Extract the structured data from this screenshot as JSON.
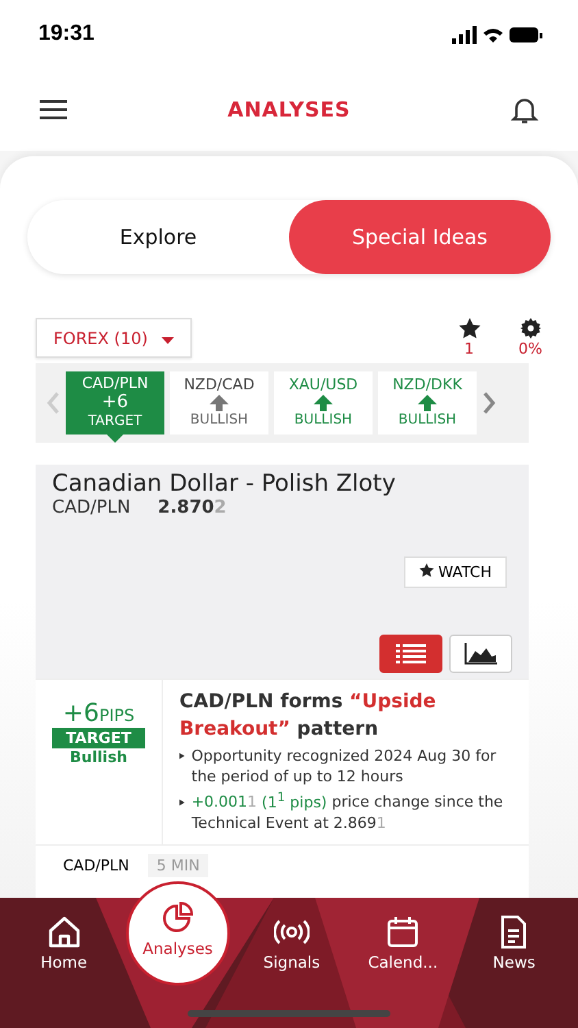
{
  "status_bar": {
    "time": "19:31"
  },
  "header": {
    "title": "ANALYSES"
  },
  "segments": [
    {
      "label": "Explore",
      "selected": false
    },
    {
      "label": "Special Ideas",
      "selected": true
    }
  ],
  "filter": {
    "label": "FOREX (10)"
  },
  "stats": {
    "watch_count": "1",
    "progress": "0%"
  },
  "tickers": [
    {
      "symbol": "CAD/PLN",
      "value": "+6",
      "status": "TARGET",
      "kind": "target",
      "selected": true
    },
    {
      "symbol": "NZD/CAD",
      "status": "BULLISH",
      "kind": "neutral",
      "selected": false
    },
    {
      "symbol": "XAU/USD",
      "status": "BULLISH",
      "kind": "up",
      "selected": false
    },
    {
      "symbol": "NZD/DKK",
      "status": "BULLISH",
      "kind": "up",
      "selected": false
    }
  ],
  "instrument": {
    "name": "Canadian Dollar - Polish Zloty",
    "symbol": "CAD/PLN",
    "price": "2.870",
    "price_tail": "2",
    "watch_label": "WATCH"
  },
  "view_toggle": [
    {
      "kind": "list",
      "selected": true
    },
    {
      "kind": "chart",
      "selected": false
    }
  ],
  "analysis": {
    "pips": "+6",
    "pips_unit": "PIPS",
    "badge": "TARGET",
    "direction": "Bullish",
    "headline": [
      {
        "text": "CAD/PLN forms ",
        "kind": "plain"
      },
      {
        "text": "“Upside Breakout”",
        "kind": "accent"
      },
      {
        "text": " pattern",
        "kind": "plain"
      }
    ],
    "bullets": [
      [
        {
          "text": "Opportunity recognized 2024 Aug 30 for the period of up to 12 hours",
          "kind": "plain"
        }
      ],
      [
        {
          "text": "+0.001",
          "kind": "green"
        },
        {
          "text": "1",
          "kind": "faint"
        },
        {
          "text": " (1$^{1}$ pips)",
          "kind": "green"
        },
        {
          "text": " price change since the Technical Event at 2.869",
          "kind": "plain"
        },
        {
          "text": "1",
          "kind": "faint"
        }
      ]
    ],
    "symbol": "CAD/PLN",
    "timeframe": "5 MIN"
  },
  "tab_bar": [
    {
      "label": "Home",
      "kind": "home",
      "selected": false
    },
    {
      "label": "Analyses",
      "kind": "analyses",
      "selected": true
    },
    {
      "label": "Signals",
      "kind": "signals",
      "selected": false
    },
    {
      "label": "Calend...",
      "kind": "calendar",
      "selected": false
    },
    {
      "label": "News",
      "kind": "news",
      "selected": false
    }
  ]
}
